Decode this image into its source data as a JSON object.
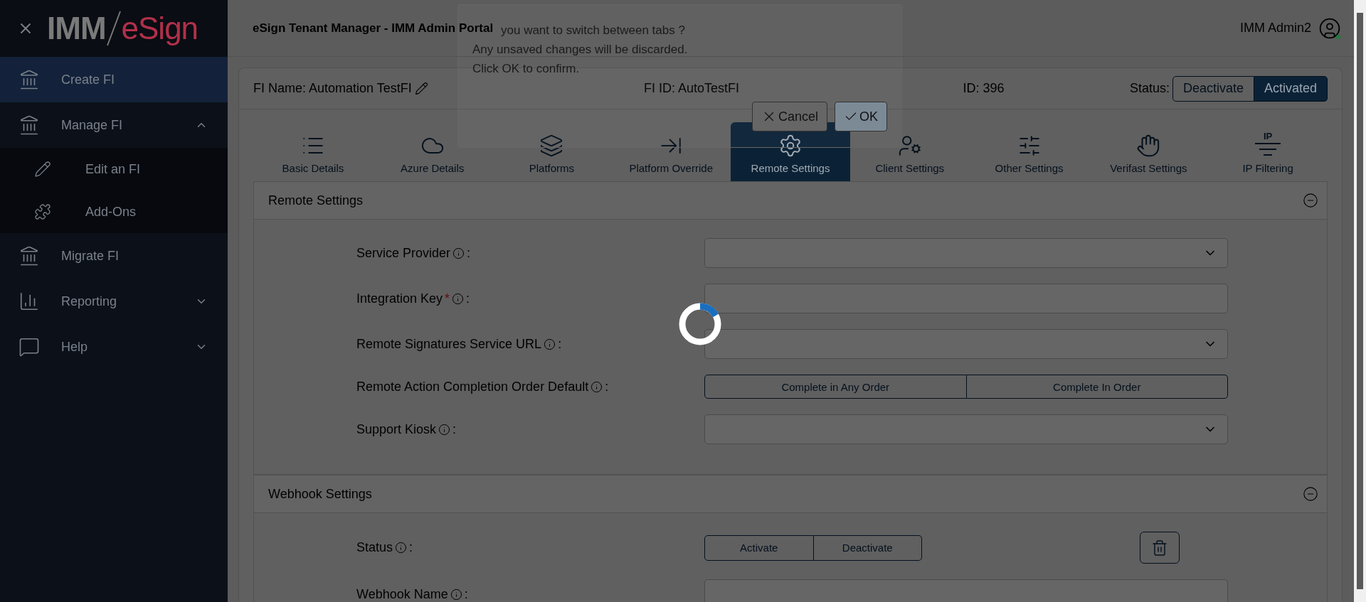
{
  "logo": {
    "prefix": "IMM",
    "brand": "eSign"
  },
  "sidebar": {
    "items": [
      {
        "label": "Create FI",
        "kind": "link",
        "selected": true
      },
      {
        "label": "Manage FI",
        "kind": "group",
        "selected": false,
        "expanded": true,
        "children": [
          {
            "label": "Edit an FI",
            "selected": false
          },
          {
            "label": "Add-Ons",
            "selected": false
          }
        ]
      },
      {
        "label": "Migrate FI",
        "kind": "link",
        "selected": false
      },
      {
        "label": "Reporting",
        "kind": "group",
        "selected": false,
        "expanded": false
      },
      {
        "label": "Help",
        "kind": "group",
        "selected": false,
        "expanded": false
      }
    ]
  },
  "header": {
    "title": "eSign Tenant Manager - IMM Admin Portal",
    "user": "IMM Admin2",
    "online": true
  },
  "fi": {
    "name": "FI Name: Automation TestFI",
    "fi_id": "FI ID: AutoTestFI",
    "id": "ID: 396",
    "status_label": "Status:",
    "status_options": [
      {
        "label": "Deactivate",
        "selected": false
      },
      {
        "label": "Activated",
        "selected": true
      }
    ]
  },
  "tabs": [
    {
      "label": "Basic Details",
      "selected": false
    },
    {
      "label": "Azure Details",
      "selected": false
    },
    {
      "label": "Platforms",
      "selected": false
    },
    {
      "label": "Platform Override",
      "selected": false
    },
    {
      "label": "Remote Settings",
      "selected": true
    },
    {
      "label": "Client Settings",
      "selected": false
    },
    {
      "label": "Other Settings",
      "selected": false
    },
    {
      "label": "Verifast Settings",
      "selected": false
    },
    {
      "label": "IP Filtering",
      "selected": false,
      "icon_text": "IP"
    }
  ],
  "sections": [
    {
      "title": "Remote Settings",
      "expanded": true,
      "label_suffix": ":",
      "fields": [
        {
          "kind": "select",
          "label": "Service Provider"
        },
        {
          "kind": "text",
          "label": "Integration Key",
          "required_mark": "*"
        },
        {
          "kind": "select",
          "label": "Remote Signatures Service URL"
        },
        {
          "kind": "toggle",
          "label": "Remote Action Completion Order Default",
          "options": [
            {
              "label": "Complete in Any Order",
              "selected": false
            },
            {
              "label": "Complete In Order",
              "selected": false
            }
          ]
        },
        {
          "kind": "select",
          "label": "Support Kiosk"
        }
      ]
    },
    {
      "title": "Webhook Settings",
      "expanded": true,
      "label_suffix": ":",
      "fields": [
        {
          "kind": "toggle",
          "label": "Status",
          "deletable": true,
          "options": [
            {
              "label": "Activate",
              "selected": false
            },
            {
              "label": "Deactivate",
              "selected": false
            }
          ]
        },
        {
          "kind": "text",
          "label": "Webhook Name"
        }
      ]
    }
  ],
  "dialog": {
    "lines": [
      "you want to switch between tabs ?",
      "Any unsaved changes will be discarded.",
      "Click OK to confirm."
    ],
    "cancel": "Cancel",
    "ok": "OK"
  },
  "loading": true
}
